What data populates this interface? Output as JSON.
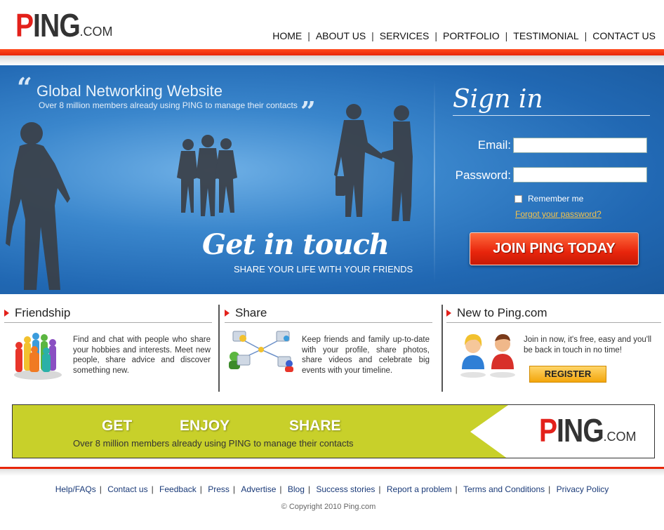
{
  "logo": {
    "p": "P",
    "ing": "ING",
    "com": ".COM"
  },
  "nav": [
    "HOME",
    "ABOUT US",
    "SERVICES",
    "PORTFOLIO",
    "TESTIMONIAL",
    "CONTACT US"
  ],
  "banner": {
    "title": "Global Networking Website",
    "subtitle": "Over 8 million members already using PING to manage their contacts",
    "headline": "Get in touch",
    "tagline": "SHARE YOUR LIFE WITH YOUR FRIENDS"
  },
  "signin": {
    "title": "Sign in",
    "email_label": "Email:",
    "email_value": "",
    "password_label": "Password:",
    "password_value": "",
    "remember_label": "Remember me",
    "forgot_label": "Forgot your password?",
    "join_label": "JOIN PING TODAY"
  },
  "features": [
    {
      "title": "Friendship",
      "text": "Find and chat with people who share your hobbies and interests. Meet new people, share advice and discover something new."
    },
    {
      "title": "Share",
      "text": "Keep friends and family up-to-date with your profile, share photos, share videos and celebrate big events with your timeline."
    },
    {
      "title": "New to Ping.com",
      "text": "Join in now, it's free, easy and you'll be back in touch in no time!",
      "button": "REGISTER"
    }
  ],
  "promo": {
    "words": [
      "GET",
      "ENJOY",
      "SHARE"
    ],
    "subtitle": "Over 8 million members already using PING to manage their contacts",
    "logo": {
      "p": "P",
      "ing": "ING",
      "com": ".COM"
    }
  },
  "footer": {
    "links": [
      "Help/FAQs",
      "Contact us",
      "Feedback",
      "Press",
      "Advertise",
      "Blog",
      "Success stories",
      "Report a problem",
      "Terms and Conditions",
      "Privacy Policy"
    ],
    "copyright": "© Copyright 2010 Ping.com"
  },
  "colors": {
    "accent": "#e3211b",
    "banner_blue": "#2168b3",
    "promo_green": "#c9d12a",
    "link_blue": "#1a3a78"
  }
}
